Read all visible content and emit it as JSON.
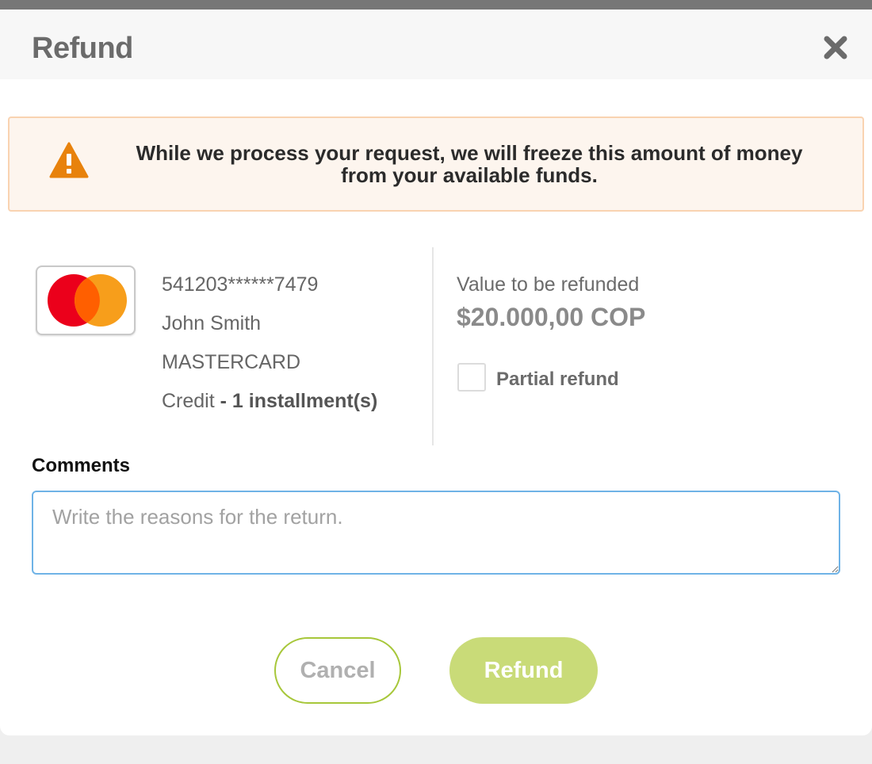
{
  "modal": {
    "title": "Refund",
    "close_icon": "close-icon"
  },
  "alert": {
    "icon": "warning-icon",
    "icon_color": "#e8820c",
    "line1": "While we process your request, we will freeze this amount of money",
    "line2": "from your available funds."
  },
  "card": {
    "brand_icon": "mastercard-logo",
    "number": "541203******7479",
    "holder": "John Smith",
    "brand": "MASTERCARD",
    "type": "Credit",
    "installments": "- 1 installment(s)"
  },
  "refund": {
    "value_label": "Value to be refunded",
    "amount": "$20.000,00 COP",
    "partial_label": "Partial refund",
    "partial_checked": false
  },
  "comments": {
    "label": "Comments",
    "placeholder": "Write the reasons for the return.",
    "value": ""
  },
  "buttons": {
    "cancel": "Cancel",
    "refund": "Refund"
  },
  "colors": {
    "accent": "#a7c73a",
    "refund_button": "#c9db78",
    "alert_bg": "#fdf5ee",
    "alert_border": "#f9d3b1",
    "input_border": "#6fb3e6"
  }
}
